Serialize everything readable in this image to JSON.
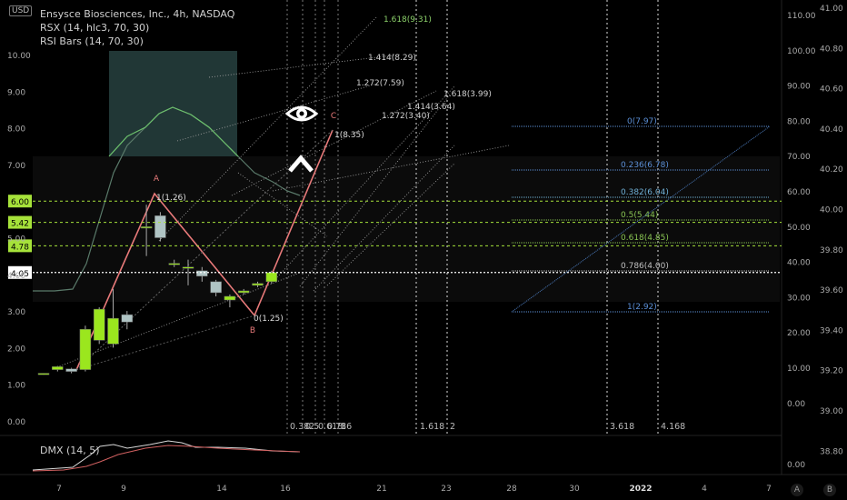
{
  "header": {
    "title": "Ensysce Biosciences, Inc., 4h, NASDAQ",
    "indicator1": "RSX (14, hlc3, 70, 30)",
    "indicator2": "RSI Bars (14, 70, 30)",
    "currency_badge": "USD"
  },
  "subpanel": {
    "label": "DMX (14, 5)",
    "axis_label": "0.00"
  },
  "axis_buttons": {
    "left": "A",
    "right": "B"
  },
  "chart_data": {
    "type": "candlestick",
    "y_left": {
      "range": [
        -0.3,
        10.8
      ],
      "ticks": [
        "0.00",
        "1.00",
        "2.00",
        "3.00",
        "4.00",
        "5.00",
        "7.00",
        "8.00",
        "9.00",
        "10.00"
      ]
    },
    "y_right_rsx": {
      "ticks": [
        "0.00",
        "10.00",
        "20.00",
        "30.00",
        "40.00",
        "50.00",
        "60.00",
        "70.00",
        "80.00",
        "90.00",
        "100.00",
        "110.00"
      ]
    },
    "y_right_secondary": {
      "ticks": [
        "38.80",
        "39.00",
        "39.20",
        "39.40",
        "39.60",
        "39.80",
        "40.00",
        "40.20",
        "40.40",
        "40.60",
        "40.80",
        "41.00"
      ]
    },
    "x_ticks": [
      "7",
      "9",
      "14",
      "16",
      "21",
      "23",
      "28",
      "30",
      "2022",
      "4",
      "7"
    ],
    "price_tags": [
      {
        "label": "6.00",
        "value": 6.0,
        "color": "#a6e23a"
      },
      {
        "label": "5.42",
        "value": 5.42,
        "color": "#a6e23a"
      },
      {
        "label": "4.78",
        "value": 4.78,
        "color": "#a6e23a"
      },
      {
        "label": "4.05",
        "value": 4.05,
        "color": "#ffffff"
      }
    ],
    "candles": [
      {
        "o": 1.28,
        "h": 1.3,
        "l": 1.26,
        "c": 1.3
      },
      {
        "o": 1.4,
        "h": 1.5,
        "l": 1.35,
        "c": 1.48
      },
      {
        "o": 1.42,
        "h": 1.45,
        "l": 1.3,
        "c": 1.35
      },
      {
        "o": 1.4,
        "h": 2.6,
        "l": 1.35,
        "c": 2.5
      },
      {
        "o": 2.2,
        "h": 3.1,
        "l": 2.1,
        "c": 3.05
      },
      {
        "o": 2.1,
        "h": 3.6,
        "l": 2.0,
        "c": 2.8
      },
      {
        "o": 2.9,
        "h": 3.0,
        "l": 2.5,
        "c": 2.7
      },
      {
        "o": 5.3,
        "h": 5.9,
        "l": 4.5,
        "c": 5.3
      },
      {
        "o": 5.6,
        "h": 5.7,
        "l": 4.9,
        "c": 5.0
      },
      {
        "o": 4.3,
        "h": 4.4,
        "l": 4.2,
        "c": 4.3
      },
      {
        "o": 4.2,
        "h": 4.4,
        "l": 3.7,
        "c": 4.2
      },
      {
        "o": 4.1,
        "h": 4.2,
        "l": 3.8,
        "c": 3.95
      },
      {
        "o": 3.8,
        "h": 3.85,
        "l": 3.4,
        "c": 3.5
      },
      {
        "o": 3.3,
        "h": 3.45,
        "l": 3.1,
        "c": 3.4
      },
      {
        "o": 3.5,
        "h": 3.6,
        "l": 3.45,
        "c": 3.55
      },
      {
        "o": 3.7,
        "h": 3.8,
        "l": 3.65,
        "c": 3.75
      },
      {
        "o": 3.8,
        "h": 4.1,
        "l": 3.75,
        "c": 4.05
      }
    ],
    "abc_pattern": [
      {
        "label": "A",
        "note": "1(1.26)",
        "value": 6.0
      },
      {
        "label": "B",
        "note": "0(1.25)",
        "value": 2.75
      },
      {
        "label": "C",
        "note": "1(8.35)",
        "value": 7.9
      }
    ],
    "fib_extension_labels": [
      "1.618(9.31)",
      "1.414(8.29)",
      "1.272(7.59)",
      "1.272(3.40)",
      "1.414(3.64)",
      "1.618(3.99)"
    ],
    "fib_retracement": [
      {
        "label": "0(7.97)",
        "color": "#5b8fd6"
      },
      {
        "label": "0.236(6.78)",
        "color": "#5b8fd6"
      },
      {
        "label": "0.382(6.04)",
        "color": "#6fb0d6"
      },
      {
        "label": "0.5(5.44)",
        "color": "#89c453"
      },
      {
        "label": "0.618(4.85)",
        "color": "#89c453"
      },
      {
        "label": "0.786(4.00)",
        "color": "#c0c0c0"
      },
      {
        "label": "1(2.92)",
        "color": "#5b8fd6"
      }
    ],
    "fib_time_labels": [
      "0.382",
      "0.5",
      "0.618",
      "0.786",
      "1",
      "1.618",
      "2",
      "3.618",
      "4.168"
    ],
    "colors": {
      "bull": "#9be61e",
      "bear": "#b0c4c4",
      "pattern": "#e87a7a",
      "grid_green": "#7fd32b",
      "fib_blue": "#4a78b8"
    }
  }
}
